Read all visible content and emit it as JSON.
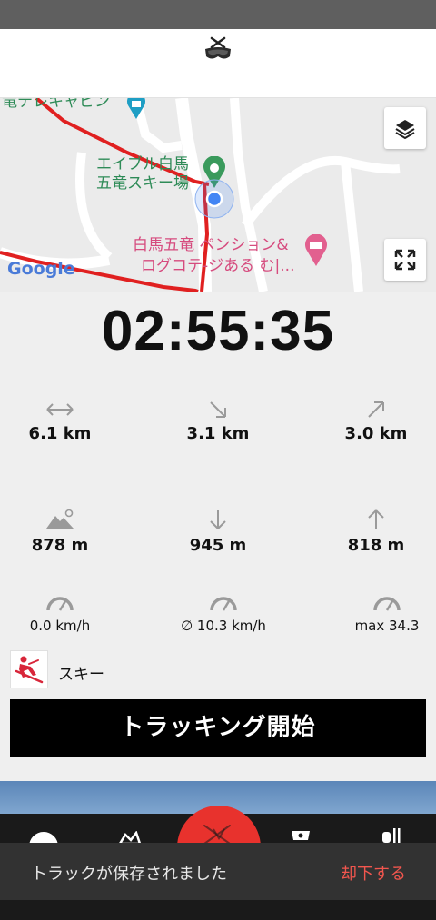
{
  "app": {
    "logo_icon": "ski-goggles-logo-icon"
  },
  "map": {
    "labels": {
      "cable_car": "竜テレキャビン",
      "resort_line1": "エイブル白馬",
      "resort_line2": "五竜スキー場",
      "pension_line1": "白馬五竜 ペンション&",
      "pension_line2": "ログコテ-ジある む|...",
      "google": "Google"
    },
    "colors": {
      "track": "#e02020",
      "place_green": "#2e8b57",
      "place_pink": "#d64b7e",
      "location_blue": "#4285f4"
    },
    "buttons": {
      "layers": "layers-icon",
      "fullscreen": "expand-icon"
    }
  },
  "tracking": {
    "elapsed": "02:55:35",
    "stats": {
      "distance": "6.1 km",
      "downhill_distance": "3.1 km",
      "uphill_distance": "3.0 km",
      "altitude": "878 m",
      "descent": "945 m",
      "ascent": "818 m",
      "current_speed": "0.0 km/h",
      "avg_speed": "∅ 10.3 km/h",
      "max_speed": "max 34.3"
    }
  },
  "activity": {
    "label": "スキー",
    "icon": "skier-icon"
  },
  "start_button": {
    "label": "トラッキング開始"
  },
  "toast": {
    "message": "トラックが保存されました",
    "action": "却下する"
  },
  "accent_color": "#e8322d"
}
